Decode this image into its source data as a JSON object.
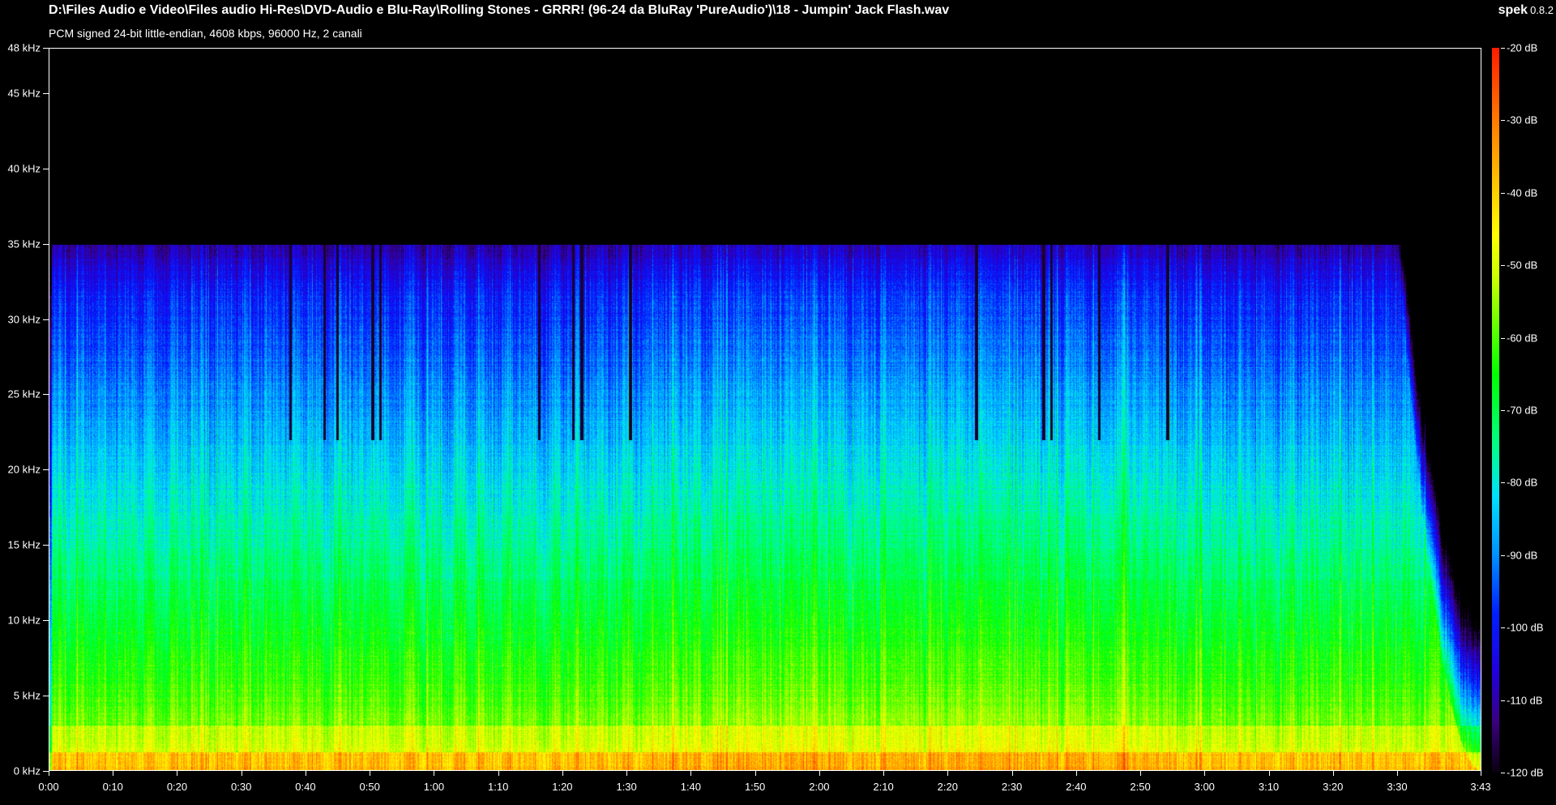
{
  "header": {
    "file_path": "D:\\Files Audio e Video\\Files audio Hi-Res\\DVD-Audio e Blu-Ray\\Rolling Stones - GRRR! (96-24 da BluRay 'PureAudio')\\18 - Jumpin' Jack Flash.wav",
    "stream_info": "PCM signed 24-bit little-endian, 4608 kbps, 96000 Hz, 2 canali"
  },
  "app": {
    "name": "spek",
    "version": "0.8.2"
  },
  "frequency_axis": {
    "labels": [
      "48 kHz",
      "45 kHz",
      "40 kHz",
      "35 kHz",
      "30 kHz",
      "25 kHz",
      "20 kHz",
      "15 kHz",
      "10 kHz",
      "5 kHz",
      "0 kHz"
    ],
    "values_khz": [
      48,
      45,
      40,
      35,
      30,
      25,
      20,
      15,
      10,
      5,
      0
    ]
  },
  "time_axis": {
    "labels": [
      "0:00",
      "0:10",
      "0:20",
      "0:30",
      "0:40",
      "0:50",
      "1:00",
      "1:10",
      "1:20",
      "1:30",
      "1:40",
      "1:50",
      "2:00",
      "2:10",
      "2:20",
      "2:30",
      "2:40",
      "2:50",
      "3:00",
      "3:10",
      "3:20",
      "3:30",
      "3:43"
    ],
    "values_s": [
      0,
      10,
      20,
      30,
      40,
      50,
      60,
      70,
      80,
      90,
      100,
      110,
      120,
      130,
      140,
      150,
      160,
      170,
      180,
      190,
      200,
      210,
      223
    ]
  },
  "level_scale": {
    "labels": [
      "-20 dB",
      "-30 dB",
      "-40 dB",
      "-50 dB",
      "-60 dB",
      "-70 dB",
      "-80 dB",
      "-90 dB",
      "-100 dB",
      "-110 dB",
      "-120 dB"
    ],
    "values_db": [
      -20,
      -30,
      -40,
      -50,
      -60,
      -70,
      -80,
      -90,
      -100,
      -110,
      -120
    ]
  },
  "spectrum": {
    "duration_s": 223,
    "max_khz": 48,
    "cutoff_khz": 35,
    "fade_start_s": 210,
    "dropout_times_s": [
      37.5,
      42.8,
      44.8,
      50.3,
      51.5,
      76.3,
      81.6,
      82.9,
      90.5,
      144.4,
      154.9,
      156.1,
      163.5,
      174.2
    ],
    "texture_change_s": [
      37,
      76,
      94,
      174
    ]
  }
}
